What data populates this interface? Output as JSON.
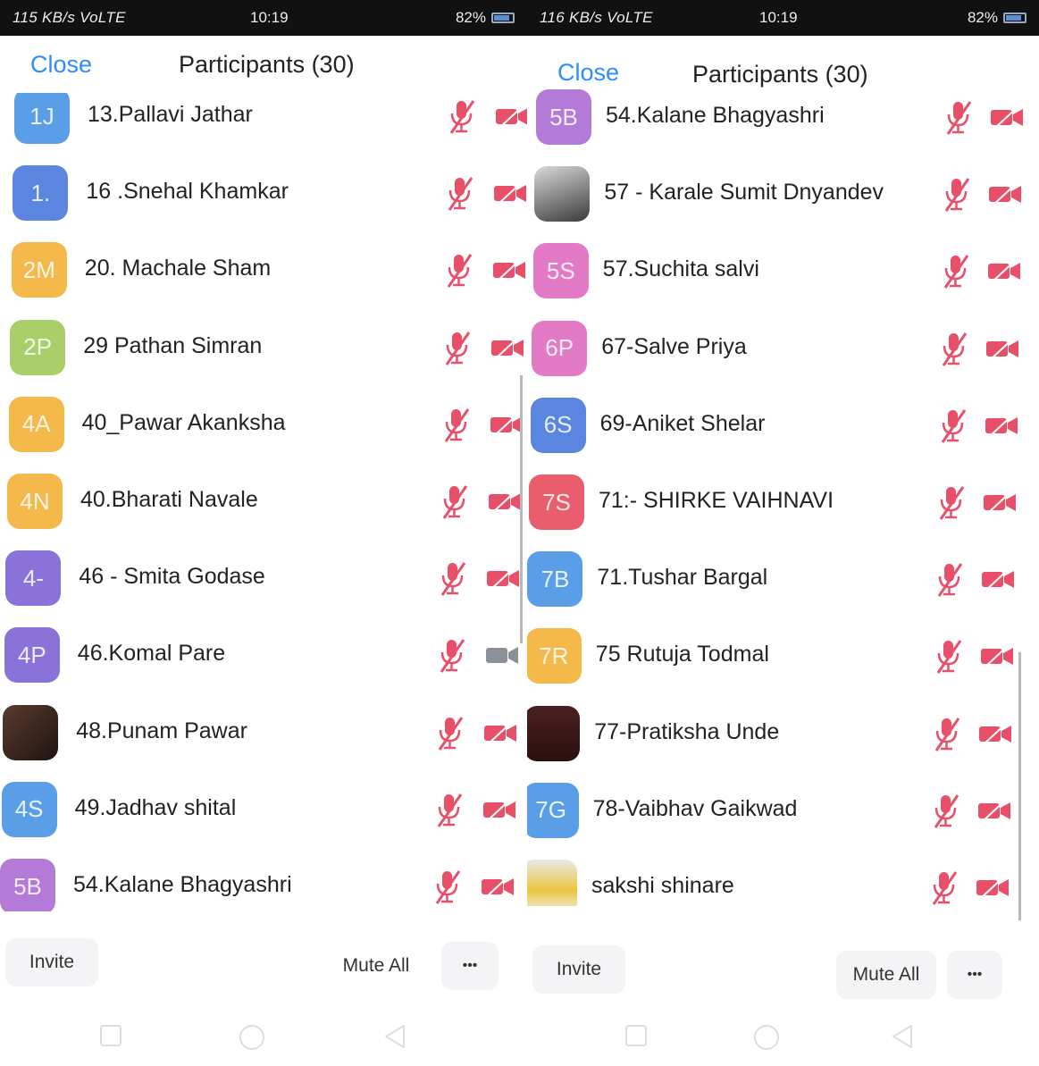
{
  "colors": {
    "accent": "#2d8cff",
    "muted_red": "#e8506a",
    "cam_gray": "#8a8f98"
  },
  "left": {
    "status": {
      "signal": "115 KB/s VoLTE",
      "time": "10:19",
      "battery": "82%"
    },
    "close_label": "Close",
    "title": "Participants (30)",
    "participants": [
      {
        "initials": "1J",
        "name": "13.Pallavi Jathar",
        "avatar_color": "#5b9ee8",
        "cam_muted": true
      },
      {
        "initials": "1.",
        "name": "16 .Snehal Khamkar",
        "avatar_color": "#5b86e0",
        "cam_muted": true
      },
      {
        "initials": "2M",
        "name": "20. Machale Sham",
        "avatar_color": "#f5b84a",
        "cam_muted": true
      },
      {
        "initials": "2P",
        "name": "29 Pathan Simran",
        "avatar_color": "#a8cf6a",
        "cam_muted": true
      },
      {
        "initials": "4A",
        "name": "40_Pawar Akanksha",
        "avatar_color": "#f5b84a",
        "cam_muted": true
      },
      {
        "initials": "4N",
        "name": "40.Bharati Navale",
        "avatar_color": "#f5b84a",
        "cam_muted": true
      },
      {
        "initials": "4-",
        "name": "46 - Smita Godase",
        "avatar_color": "#8a73d8",
        "cam_muted": true
      },
      {
        "initials": "4P",
        "name": "46.Komal Pare",
        "avatar_color": "#8a73d8",
        "cam_muted": false
      },
      {
        "initials": "",
        "name": "48.Punam Pawar",
        "avatar_color": "photo",
        "cam_muted": true
      },
      {
        "initials": "4S",
        "name": "49.Jadhav shital",
        "avatar_color": "#5b9ee8",
        "cam_muted": true
      },
      {
        "initials": "5B",
        "name": "54.Kalane Bhagyashri",
        "avatar_color": "#b47ad8",
        "cam_muted": true
      }
    ],
    "invite_label": "Invite",
    "mute_all_label": "Mute All",
    "more_label": "•••"
  },
  "right": {
    "status": {
      "signal": "116 KB/s VoLTE",
      "time": "10:19",
      "battery": "82%"
    },
    "close_label": "Close",
    "title": "Participants (30)",
    "participants": [
      {
        "initials": "5B",
        "name": "54.Kalane Bhagyashri",
        "avatar_color": "#b47ad8",
        "cam_muted": true
      },
      {
        "initials": "",
        "name": "57 - Karale Sumit Dnyandev",
        "avatar_color": "photo2",
        "cam_muted": true
      },
      {
        "initials": "5S",
        "name": "57.Suchita salvi",
        "avatar_color": "#e27ac5",
        "cam_muted": true
      },
      {
        "initials": "6P",
        "name": "67-Salve Priya",
        "avatar_color": "#e27ac5",
        "cam_muted": true
      },
      {
        "initials": "6S",
        "name": "69-Aniket Shelar",
        "avatar_color": "#5b86e0",
        "cam_muted": true
      },
      {
        "initials": "7S",
        "name": "71:- SHIRKE  VAIHNAVI",
        "avatar_color": "#ea5d6c",
        "cam_muted": true
      },
      {
        "initials": "7B",
        "name": "71.Tushar Bargal",
        "avatar_color": "#5b9ee8",
        "cam_muted": true
      },
      {
        "initials": "7R",
        "name": "75 Rutuja Todmal",
        "avatar_color": "#f5b84a",
        "cam_muted": true
      },
      {
        "initials": "",
        "name": "77-Pratiksha Unde",
        "avatar_color": "photo4",
        "cam_muted": true
      },
      {
        "initials": "7G",
        "name": "78-Vaibhav Gaikwad",
        "avatar_color": "#5b9ee8",
        "cam_muted": true
      },
      {
        "initials": "",
        "name": "sakshi shinare",
        "avatar_color": "photo3",
        "cam_muted": true
      }
    ],
    "invite_label": "Invite",
    "mute_all_label": "Mute All",
    "more_label": "•••"
  }
}
